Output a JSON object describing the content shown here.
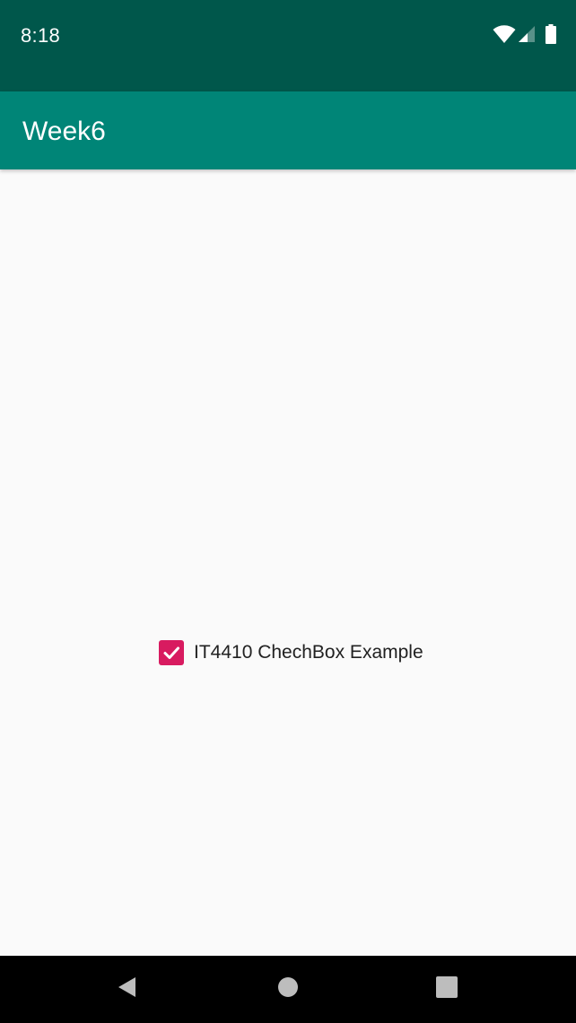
{
  "status_bar": {
    "time": "8:18",
    "icons": [
      "wifi-icon",
      "cell-signal-icon",
      "battery-icon"
    ],
    "background": "#00574b"
  },
  "app_bar": {
    "title": "Week6",
    "background": "#008577"
  },
  "content": {
    "checkbox": {
      "label": "IT4410 ChechBox Example",
      "checked": true,
      "accent": "#d81b60"
    }
  },
  "nav_bar": {
    "buttons": [
      "back-icon",
      "home-icon",
      "recents-icon"
    ]
  }
}
